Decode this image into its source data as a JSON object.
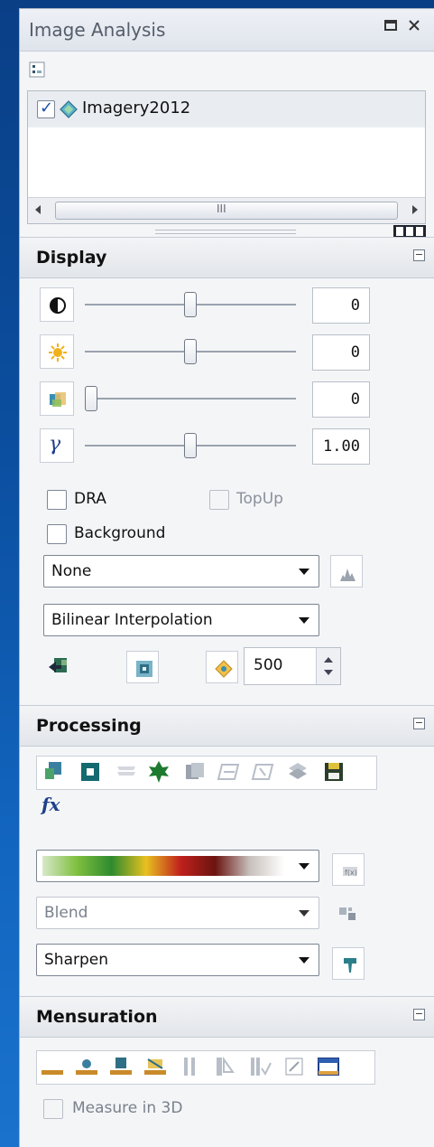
{
  "window": {
    "title": "Image Analysis",
    "restore_icon": "restore-window-icon",
    "close_icon": "close-icon"
  },
  "layers": [
    {
      "name": "Imagery2012",
      "checked": true,
      "icon": "raster-layer-icon"
    }
  ],
  "scrollbar": {
    "thumb_grip": "III"
  },
  "display": {
    "title": "Display",
    "sliders": [
      {
        "icon": "contrast-icon",
        "value": "0",
        "level_percent": 50
      },
      {
        "icon": "brightness-icon",
        "value": "0",
        "level_percent": 50
      },
      {
        "icon": "transparency-icon",
        "value": "0",
        "level_percent": 0
      },
      {
        "icon": "gamma-icon",
        "value": "1.00",
        "level_percent": 50
      }
    ],
    "gamma_glyph": "γ",
    "dra_label": "DRA",
    "topup_label": "TopUp",
    "background_label": "Background",
    "stretch_select": "None",
    "resample_select": "Bilinear Interpolation",
    "scale_value": "500"
  },
  "processing": {
    "title": "Processing",
    "fx_label": "fx",
    "colormap_ramp": [
      "#d8e8c8",
      "#7fbf3f",
      "#2e8b2e",
      "#e8c020",
      "#c0201c",
      "#6b1410",
      "#c8c0bc",
      "#ffffff"
    ],
    "blend_select": "Blend",
    "sharpen_select": "Sharpen"
  },
  "mensuration": {
    "title": "Mensuration",
    "measure3d_label": "Measure in 3D"
  },
  "colors": {
    "background": "#0b4fa0",
    "panel": "#f4f5f7",
    "accent": "#1e4fa8"
  }
}
